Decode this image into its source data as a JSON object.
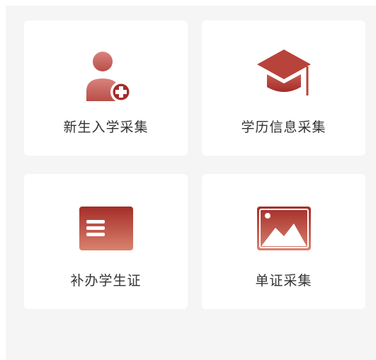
{
  "cards": [
    {
      "label": "新生入学采集",
      "icon": "person-add-icon"
    },
    {
      "label": "学历信息采集",
      "icon": "graduation-cap-icon"
    },
    {
      "label": "补办学生证",
      "icon": "id-card-icon"
    },
    {
      "label": "单证采集",
      "icon": "image-icon"
    }
  ],
  "colors": {
    "accent_light": "#d9826f",
    "accent_dark": "#a42d28",
    "background": "#f5f5f5",
    "card": "#ffffff",
    "text": "#333333"
  }
}
